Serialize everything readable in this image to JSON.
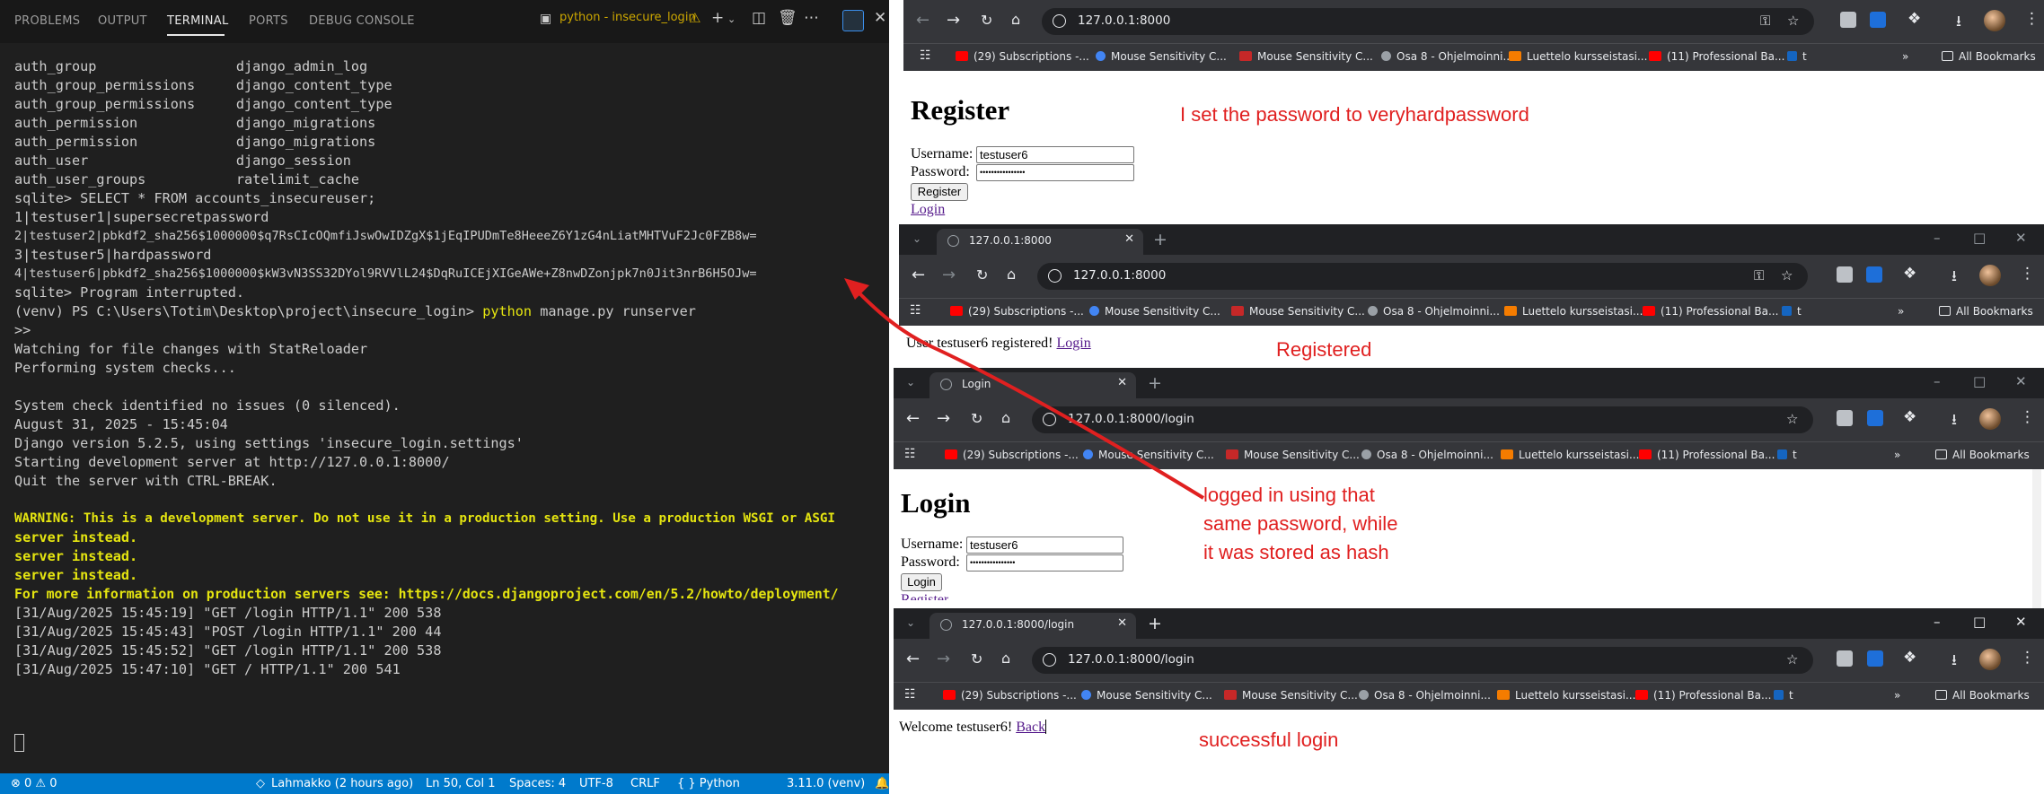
{
  "vscode": {
    "panel_tabs": [
      "PROBLEMS",
      "OUTPUT",
      "TERMINAL",
      "PORTS",
      "DEBUG CONSOLE"
    ],
    "active_tab": "TERMINAL",
    "terminal_title": "python - insecure_login",
    "terminal_lines": [
      "auth_group                 django_admin_log",
      "auth_group_permissions     django_content_type",
      "auth_group_permissions     django_content_type",
      "auth_permission            django_migrations",
      "auth_permission            django_migrations",
      "auth_user                  django_session",
      "auth_user_groups           ratelimit_cache",
      "sqlite> SELECT * FROM accounts_insecureuser;",
      "1|testuser1|supersecretpassword",
      "2|testuser2|pbkdf2_sha256$1000000$q7RsCIcOQmfiJswOwIDZgX$1jEqIPUDmTe8HeeeZ6Y1zG4nLiatMHTVuF2Jc0FZB8w=",
      "3|testuser5|hardpassword",
      "4|testuser6|pbkdf2_sha256$1000000$kW3vN3SS32DYol9RVVlL24$DqRuICEjXIGeAWe+Z8nwDZonjpk7n0Jit3nrB6H5OJw=",
      "sqlite> Program interrupted.",
      "",
      ">>",
      "Watching for file changes with StatReloader",
      "Performing system checks...",
      "",
      "System check identified no issues (0 silenced).",
      "August 31, 2025 - 15:45:04",
      "Django version 5.2.5, using settings 'insecure_login.settings'",
      "Starting development server at http://127.0.0.1:8000/",
      "Quit the server with CTRL-BREAK.",
      "",
      "WARNING: This is a development server. Do not use it in a production setting. Use a production WSGI or ASGI",
      "server instead.",
      "server instead.",
      "server instead.",
      "For more information on production servers see: https://docs.djangoproject.com/en/5.2/howto/deployment/",
      "[31/Aug/2025 15:45:19] \"GET /login HTTP/1.1\" 200 538",
      "[31/Aug/2025 15:45:43] \"POST /login HTTP/1.1\" 200 44",
      "[31/Aug/2025 15:45:52] \"GET /login HTTP/1.1\" 200 538",
      "[31/Aug/2025 15:47:10] \"GET / HTTP/1.1\" 200 541"
    ],
    "prompt_line": {
      "prefix": "(venv) PS C:\\Users\\Totim\\Desktop\\project\\insecure_login> ",
      "command": "python",
      "args": " manage.py runserver"
    },
    "status": {
      "problems": "⊗ 0 ⚠ 0",
      "git": "Lahmakko (2 hours ago)",
      "position": "Ln 50, Col 1",
      "spaces": "Spaces: 4",
      "encoding": "UTF-8",
      "eol": "CRLF",
      "language": "{ } Python",
      "interpreter": "3.11.0 (venv)"
    }
  },
  "browser": {
    "bookmarks": [
      "(29) Subscriptions -...",
      "Mouse Sensitivity C...",
      "Mouse Sensitivity C...",
      "Osa 8 - Ohjelmoinni...",
      "Luettelo kursseistasi...",
      "(11) Professional Ba...",
      "t"
    ],
    "all_bookmarks": "All Bookmarks",
    "windows": [
      {
        "url": "127.0.0.1:8000",
        "heading": "Register",
        "username_label": "Username:",
        "username_value": "testuser6",
        "password_label": "Password:",
        "password_value": "••••••••••••••••",
        "button": "Register",
        "link": "Login",
        "annotation": "I set the password to veryhardpassword"
      },
      {
        "tab_title": "127.0.0.1:8000",
        "url": "127.0.0.1:8000",
        "message": "User testuser6 registered!",
        "link": "Login",
        "annotation": "Registered"
      },
      {
        "tab_title": "Login",
        "url": "127.0.0.1:8000/login",
        "heading": "Login",
        "username_label": "Username:",
        "username_value": "testuser6",
        "password_label": "Password:",
        "password_value": "••••••••••••••••",
        "button": "Login",
        "link": "Register",
        "annotation": "logged in using that\nsame password, while\nit was stored as hash"
      },
      {
        "tab_title": "127.0.0.1:8000/login",
        "url": "127.0.0.1:8000/login",
        "message": "Welcome testuser6!",
        "link": "Back",
        "annotation": "successful login"
      }
    ]
  },
  "colors": {
    "annotation": "#e02020",
    "status_bar": "#007acc",
    "warning_text": "#e5e510"
  }
}
